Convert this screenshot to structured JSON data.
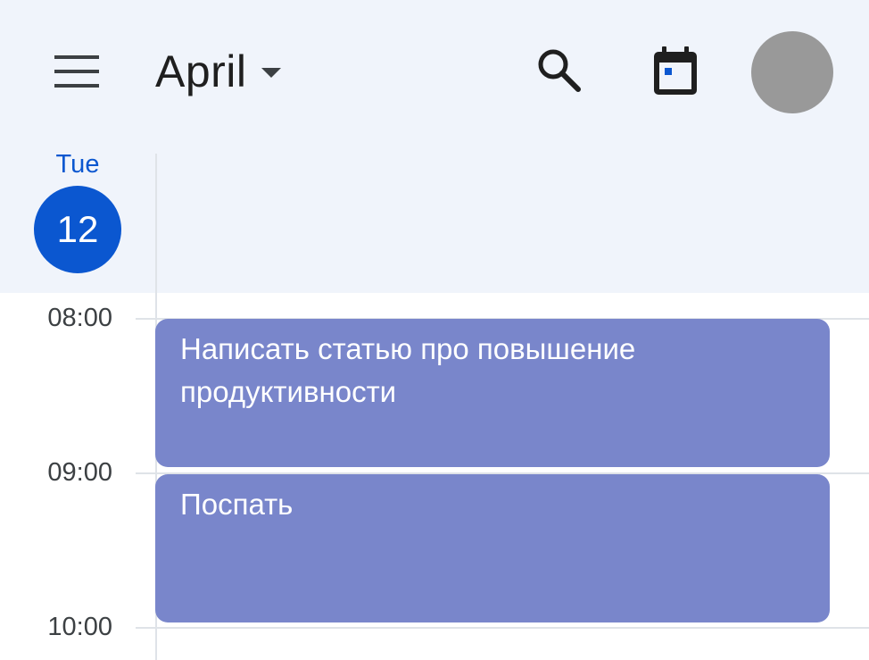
{
  "header": {
    "month": "April",
    "icons": {
      "menu": "menu-icon",
      "dropdown": "arrow-drop-down-icon",
      "search": "search-icon",
      "today": "calendar-today-icon"
    }
  },
  "day": {
    "name": "Tue",
    "number": "12"
  },
  "hours": [
    "08:00",
    "09:00",
    "10:00"
  ],
  "events": [
    {
      "title": "Написать статью про повышение продуктивности"
    },
    {
      "title": "Поспать"
    }
  ],
  "colors": {
    "accent": "#0b57d0",
    "event": "#7986cb",
    "header_bg": "#f0f4fb",
    "avatar": "#999999"
  }
}
